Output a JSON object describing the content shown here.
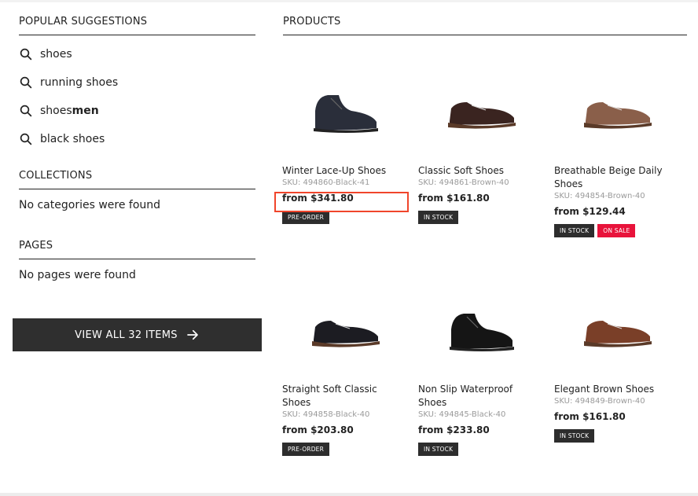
{
  "sidebar": {
    "popular_title": "POPULAR SUGGESTIONS",
    "suggestions": [
      {
        "text": "shoes",
        "bold": ""
      },
      {
        "text": "running shoes",
        "bold": ""
      },
      {
        "text": "shoes",
        "bold": "men"
      },
      {
        "text": "black shoes",
        "bold": ""
      }
    ],
    "collections_title": "COLLECTIONS",
    "collections_empty": "No categories were found",
    "pages_title": "PAGES",
    "pages_empty": "No pages were found"
  },
  "view_all_label": "VIEW ALL 32 ITEMS",
  "products": {
    "title": "PRODUCTS",
    "items": [
      {
        "name": "Winter Lace-Up Shoes",
        "sku": "SKU: 494860-Black-41",
        "price": "from $341.80",
        "badges": [
          "PRE-ORDER"
        ],
        "shoe_color": "#2a2e3a",
        "style": "boot"
      },
      {
        "name": "Classic Soft Shoes",
        "sku": "SKU: 494861-Brown-40",
        "price": "from $161.80",
        "badges": [
          "IN STOCK"
        ],
        "shoe_color": "#3a2420",
        "style": "low"
      },
      {
        "name": "Breathable Beige Daily Shoes",
        "sku": "SKU: 494854-Brown-40",
        "price": "from $129.44",
        "badges": [
          "IN STOCK",
          "ON SALE"
        ],
        "shoe_color": "#8a5f4a",
        "style": "low"
      },
      {
        "name": "Straight Soft Classic Shoes",
        "sku": "SKU: 494858-Black-40",
        "price": "from $203.80",
        "badges": [
          "PRE-ORDER"
        ],
        "shoe_color": "#1c1c22",
        "style": "low"
      },
      {
        "name": "Non Slip Waterproof Shoes",
        "sku": "SKU: 494845-Black-40",
        "price": "from $233.80",
        "badges": [
          "IN STOCK"
        ],
        "shoe_color": "#151515",
        "style": "boot"
      },
      {
        "name": "Elegant Brown Shoes",
        "sku": "SKU: 494849-Brown-40",
        "price": "from $161.80",
        "badges": [
          "IN STOCK"
        ],
        "shoe_color": "#7a3f28",
        "style": "low"
      }
    ]
  }
}
